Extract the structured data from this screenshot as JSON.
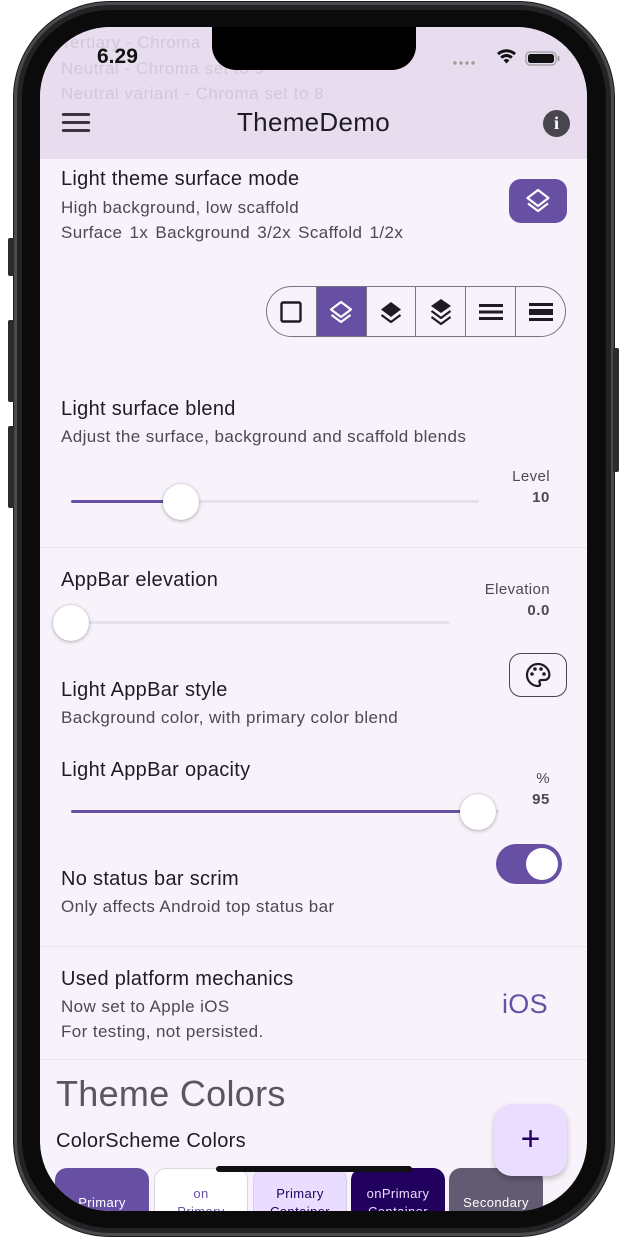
{
  "status": {
    "time": "6.29"
  },
  "background_text": [
    "Tertiary - Chroma",
    "Neutral - Chroma set to 5",
    "Neutral variant - Chroma set to 8"
  ],
  "appbar": {
    "title": "ThemeDemo",
    "menu_icon": "hamburger-menu-icon",
    "info_icon": "info-icon"
  },
  "surface_mode": {
    "title": "Light theme surface mode",
    "subtitle": "High background, low scaffold",
    "detail": "Surface 1x  Background 3/2x  Scaffold 1/2x",
    "selected_index": 1,
    "options": [
      "square-outline-icon",
      "layers-outline-icon",
      "layers-filled-icon",
      "stack-icon",
      "horizontal-bars-icon",
      "horizontal-bars-thick-icon"
    ]
  },
  "surface_blend": {
    "title": "Light surface blend",
    "subtitle": "Adjust the surface, background and scaffold blends",
    "label": "Level",
    "value": "10",
    "slider_fraction": 0.27
  },
  "appbar_elevation": {
    "title": "AppBar elevation",
    "label": "Elevation",
    "value": "0.0",
    "slider_fraction": 0.0
  },
  "appbar_style": {
    "title": "Light AppBar style",
    "subtitle": "Background color, with primary color blend",
    "icon": "palette-icon"
  },
  "appbar_opacity": {
    "title": "Light AppBar opacity",
    "label": "%",
    "value": "95",
    "slider_fraction": 0.95
  },
  "status_scrim": {
    "title": "No status bar scrim",
    "subtitle": "Only affects Android top status bar",
    "enabled": true
  },
  "platform": {
    "title": "Used platform mechanics",
    "line1": "Now set to Apple iOS",
    "line2": "For testing, not persisted.",
    "badge": "iOS"
  },
  "theme_colors": {
    "title": "Theme Colors",
    "subtitle": "ColorScheme Colors",
    "swatches": [
      {
        "label": "Primary",
        "bg": "#6750a4",
        "fg": "#ffffff"
      },
      {
        "label": "on\nPrimary",
        "bg": "#ffffff",
        "fg": "#6750a4"
      },
      {
        "label": "Primary\nContainer",
        "bg": "#e9ddff",
        "fg": "#22005d"
      },
      {
        "label": "onPrimary\nContainer",
        "bg": "#22005d",
        "fg": "#e9ddff"
      },
      {
        "label": "Secondary",
        "bg": "#625b71",
        "fg": "#ffffff"
      }
    ]
  },
  "fab": {
    "label": "+"
  },
  "colors": {
    "primary": "#6750a4",
    "appbar": "#e8ddef",
    "surface": "#f8f2fa"
  }
}
